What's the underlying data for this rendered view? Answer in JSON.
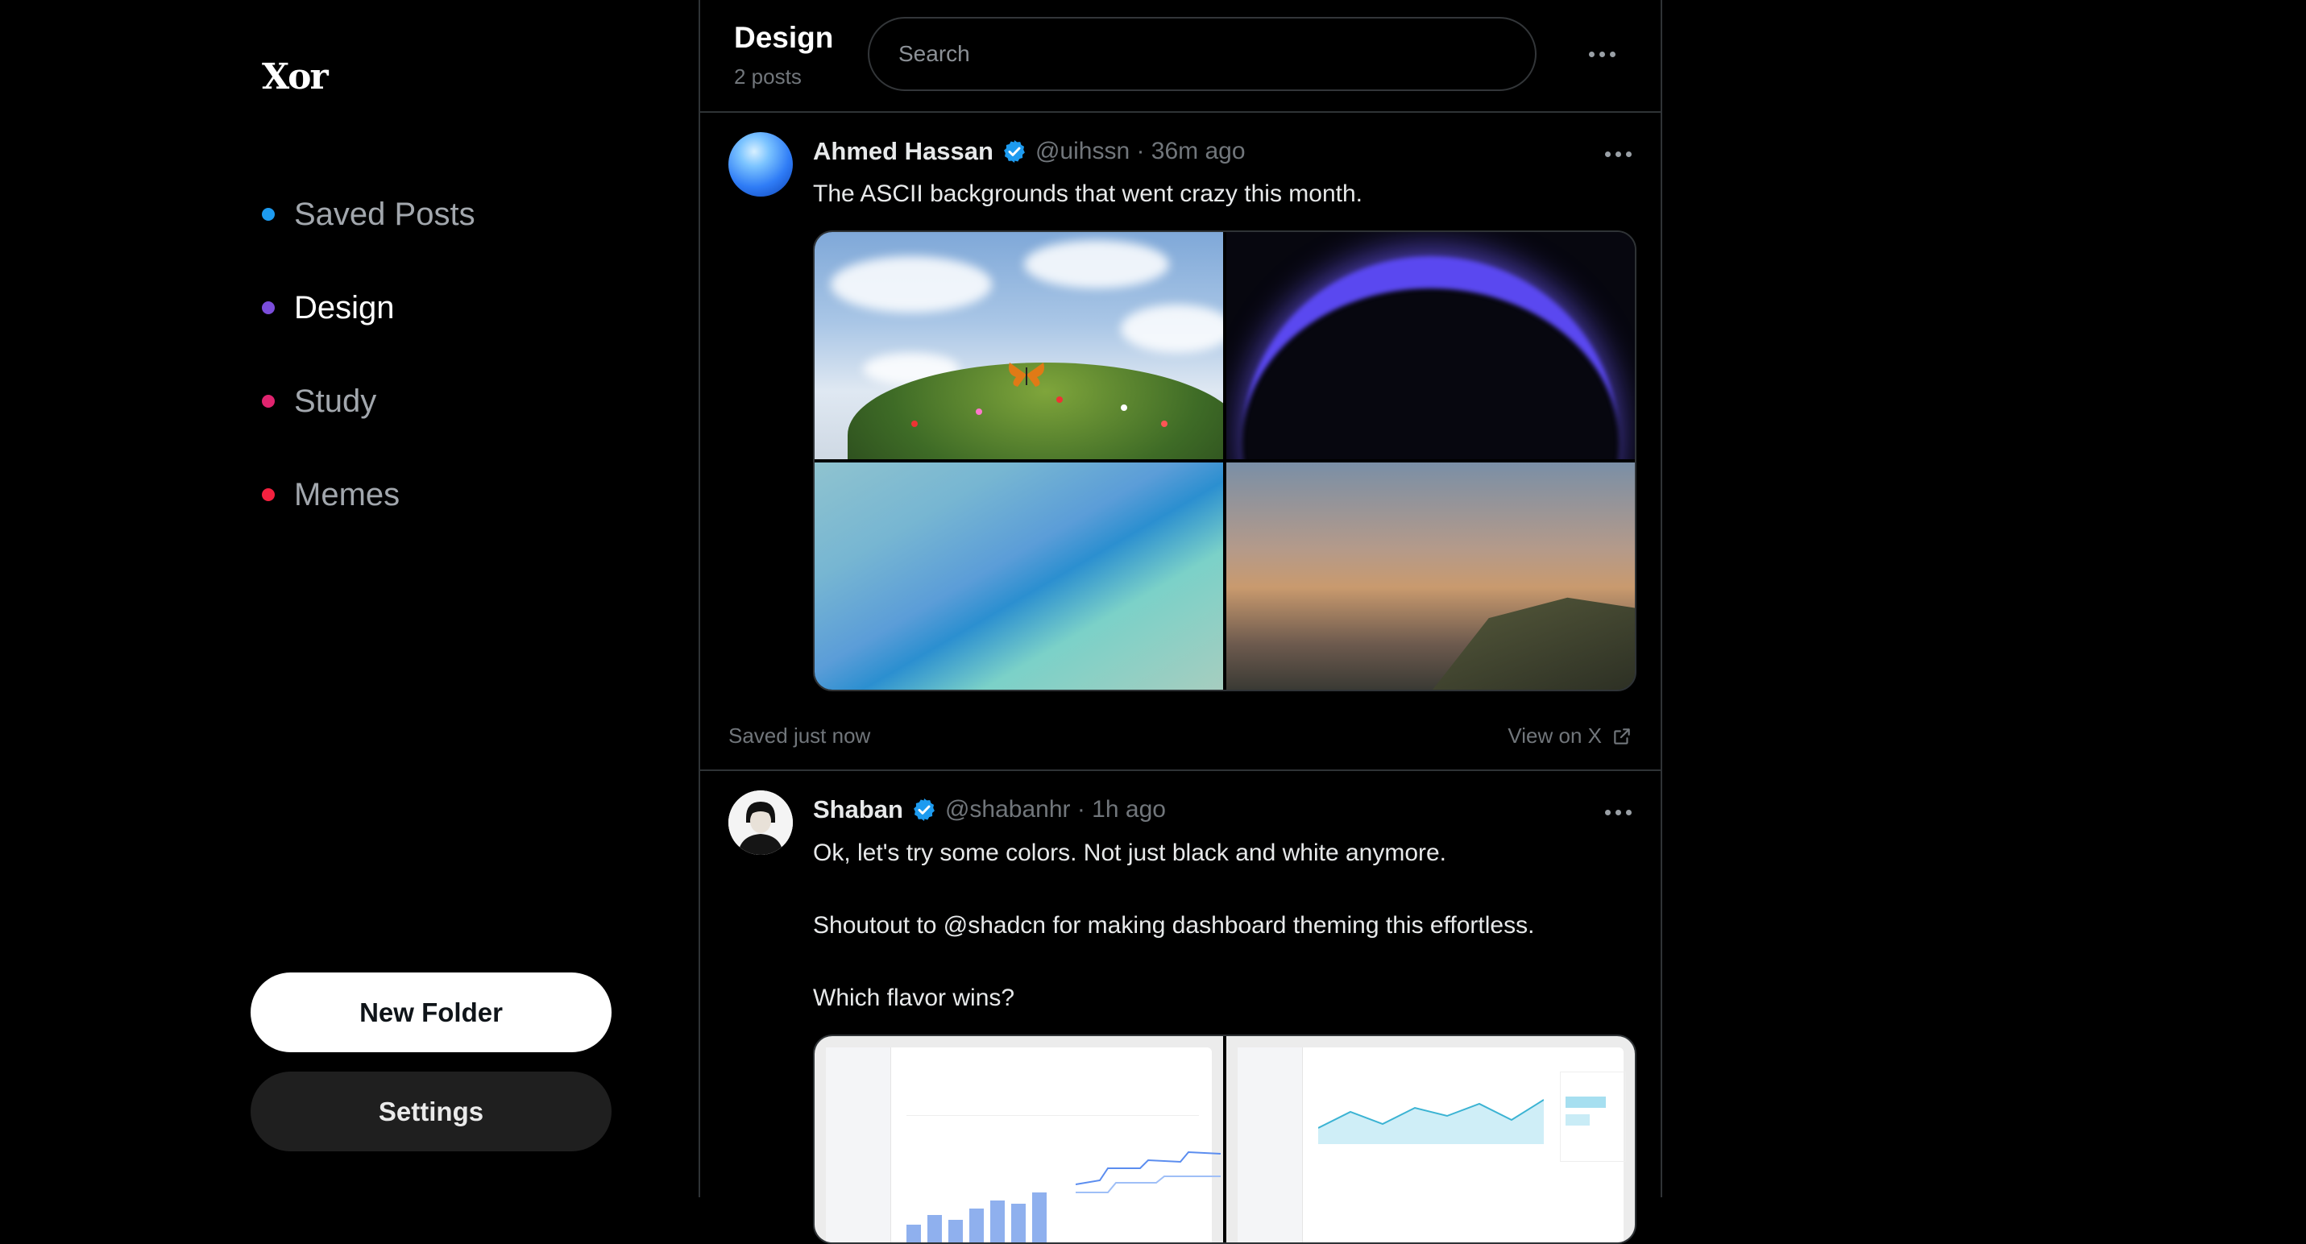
{
  "app": {
    "logo": "Xor"
  },
  "sidebar": {
    "folders": [
      {
        "label": "Saved Posts",
        "color": "#1d9bf0",
        "active": false
      },
      {
        "label": "Design",
        "color": "#7b4ddb",
        "active": true
      },
      {
        "label": "Study",
        "color": "#e0246f",
        "active": false
      },
      {
        "label": "Memes",
        "color": "#f4213f",
        "active": false
      }
    ],
    "new_folder_label": "New Folder",
    "settings_label": "Settings"
  },
  "header": {
    "title": "Design",
    "count": "2 posts",
    "search_placeholder": "Search"
  },
  "posts": [
    {
      "author": "Ahmed Hassan",
      "verified": true,
      "meta": "@uihssn · 36m ago",
      "text": "The ASCII backgrounds that went crazy this month.",
      "saved": "Saved just now",
      "view_label": "View on X"
    },
    {
      "author": "Shaban",
      "verified": true,
      "meta": "@shabanhr · 1h ago",
      "text": "Ok, let's try some colors. Not just black and white anymore.\n\nShoutout to @shadcn for making dashboard theming this effortless.\n\nWhich flavor wins?"
    }
  ],
  "colors": {
    "accent": "#1d9bf0",
    "border": "#2f3336",
    "muted": "#71767b"
  }
}
